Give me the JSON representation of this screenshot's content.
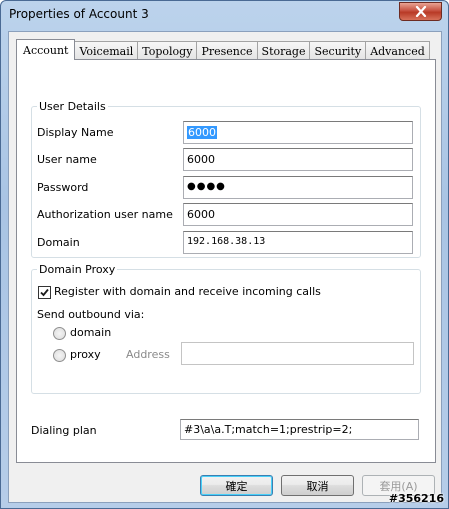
{
  "window": {
    "title": "Properties of Account 3"
  },
  "tabs": [
    {
      "label": "Account",
      "active": true
    },
    {
      "label": "Voicemail",
      "active": false
    },
    {
      "label": "Topology",
      "active": false
    },
    {
      "label": "Presence",
      "active": false
    },
    {
      "label": "Storage",
      "active": false
    },
    {
      "label": "Security",
      "active": false
    },
    {
      "label": "Advanced",
      "active": false
    }
  ],
  "user_details": {
    "legend": "User Details",
    "display_name_label": "Display Name",
    "display_name_value": "6000",
    "user_name_label": "User name",
    "user_name_value": "6000",
    "password_label": "Password",
    "password_value": "●●●●",
    "auth_user_label": "Authorization user name",
    "auth_user_value": "6000",
    "domain_label": "Domain",
    "domain_value": "192.168.38.13"
  },
  "domain_proxy": {
    "legend": "Domain Proxy",
    "register_label": "Register with domain and receive incoming calls",
    "register_checked": true,
    "send_outbound_label": "Send outbound via:",
    "domain_option": "domain",
    "proxy_option": "proxy",
    "address_label": "Address",
    "address_value": ""
  },
  "dialing_plan": {
    "label": "Dialing plan",
    "value": "#3\\a\\a.T;match=1;prestrip=2;"
  },
  "buttons": {
    "ok": "確定",
    "cancel": "取消",
    "apply": "套用(A)"
  },
  "watermark": "#356216"
}
